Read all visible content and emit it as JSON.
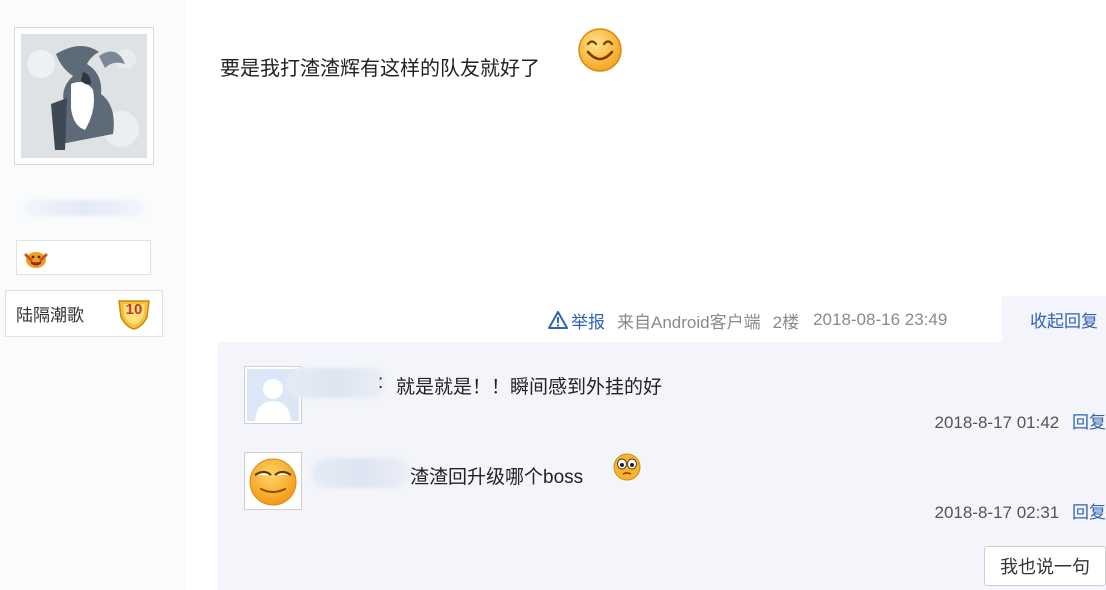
{
  "author": {
    "badge_icon": "cheer-emoticon-icon",
    "level_title": "陆隔潮歌",
    "level_number": "10"
  },
  "post": {
    "text": "要是我打渣渣辉有这样的队友就好了",
    "emoticon": "grin-smiley-icon"
  },
  "post_footer": {
    "report_label": "举报",
    "client": "来自Android客户端",
    "floor": "2楼",
    "timestamp": "2018-08-16 23:49",
    "collapse_label": "收起回复"
  },
  "replies": [
    {
      "avatar": "default-user-avatar",
      "text_prefix": ":",
      "text": "就是就是！！瞬间感到外挂的好",
      "time": "2018-8-17 01:42",
      "reply_label": "回复"
    },
    {
      "avatar": "smiley-avatar",
      "text": "渣渣回升级哪个boss",
      "emoticon": "staring-eyes-icon",
      "time": "2018-8-17 02:31",
      "reply_label": "回复"
    }
  ],
  "speak_button": "我也说一句",
  "colors": {
    "link_blue": "#2d64b3",
    "reply_bg": "#f3f5fa",
    "badge_gold": "#f5c136"
  }
}
